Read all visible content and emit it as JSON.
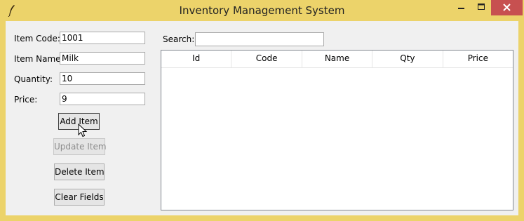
{
  "window": {
    "title": "Inventory Management System"
  },
  "form": {
    "item_code_label": "Item Code:",
    "item_code_value": "1001",
    "item_name_label": "Item Name:",
    "item_name_value": "Milk",
    "quantity_label": "Quantity:",
    "quantity_value": "10",
    "price_label": "Price:",
    "price_value": "9"
  },
  "buttons": {
    "add": "Add Item",
    "update": "Update Item",
    "delete": "Delete Item",
    "clear": "Clear Fields"
  },
  "search": {
    "label": "Search:",
    "value": ""
  },
  "table": {
    "columns": [
      "Id",
      "Code",
      "Name",
      "Qty",
      "Price"
    ],
    "rows": []
  },
  "icons": {
    "app": "feather-icon",
    "minimize": "minimize-icon",
    "maximize": "maximize-icon",
    "close": "close-icon"
  },
  "colors": {
    "titlebar": "#ecd36a",
    "close_button": "#c75050",
    "client_bg": "#f0f0f0"
  }
}
